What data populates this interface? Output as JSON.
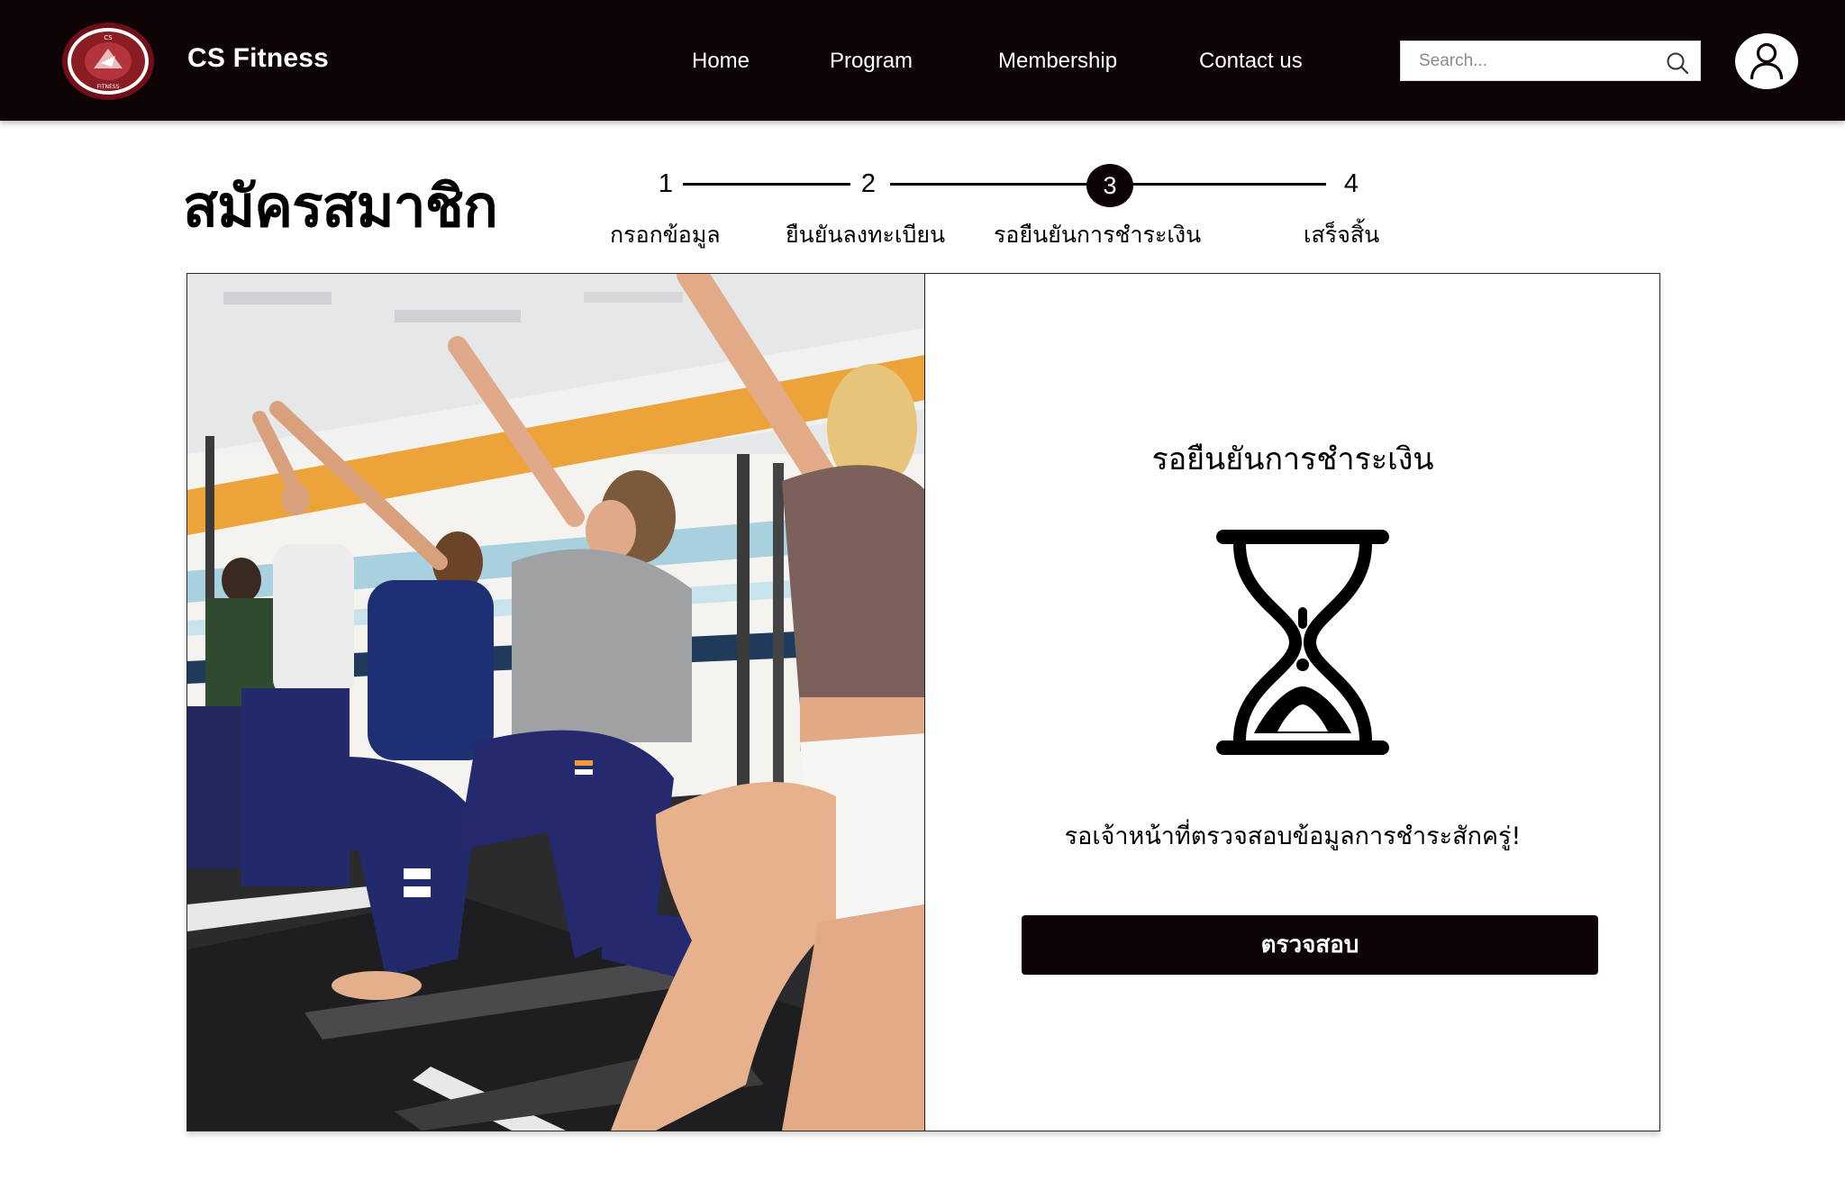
{
  "header": {
    "brand": "CS Fitness",
    "logo": {
      "top_text": "CS",
      "bottom_text": "FITNESS"
    },
    "nav": [
      "Home",
      "Program",
      "Membership",
      "Contact us"
    ],
    "search": {
      "placeholder": "Search...",
      "icon": "search-icon"
    },
    "avatar_icon": "user-icon"
  },
  "page": {
    "title": "สมัครสมาชิก"
  },
  "stepper": {
    "current": 3,
    "steps": [
      {
        "number": "1",
        "label": "กรอกข้อมูล"
      },
      {
        "number": "2",
        "label": "ยืนยันลงทะเบียน"
      },
      {
        "number": "3",
        "label": "รอยืนยันการชำระเงิน"
      },
      {
        "number": "4",
        "label": "เสร็จสิ้น"
      }
    ]
  },
  "status": {
    "title": "รอยืนยันการชำระเงิน",
    "icon": "hourglass-icon",
    "message": "รอเจ้าหน้าที่ตรวจสอบข้อมูลการชำระสักครู่!",
    "button_label": "ตรวจสอบ"
  },
  "colors": {
    "header_bg": "#0e0405",
    "button_bg": "#0e0405",
    "logo_red": "#8a1c24",
    "text": "#000000"
  }
}
